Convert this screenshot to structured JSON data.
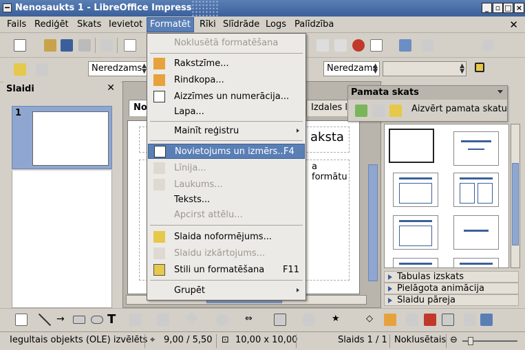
{
  "window": {
    "title": "Nenosaukts 1 - LibreOffice Impress"
  },
  "menubar": {
    "items": [
      {
        "label": "Fails",
        "name": "menu-fails"
      },
      {
        "label": "Rediģēt",
        "name": "menu-rediget"
      },
      {
        "label": "Skats",
        "name": "menu-skats"
      },
      {
        "label": "Ievietot",
        "name": "menu-ievietot"
      },
      {
        "label": "Formatēt",
        "name": "menu-formatet"
      },
      {
        "label": "Rīki",
        "name": "menu-riki"
      },
      {
        "label": "Slīdrāde",
        "name": "menu-slidrade"
      },
      {
        "label": "Logs",
        "name": "menu-logs"
      },
      {
        "label": "Palīdzība",
        "name": "menu-palidziba"
      }
    ]
  },
  "format_menu": {
    "items": [
      {
        "label": "Noklusētā formatēšana",
        "disabled": true
      },
      {
        "label": "Rakstzīme..."
      },
      {
        "label": "Rindkopa..."
      },
      {
        "label": "Aizzīmes un numerācija..."
      },
      {
        "label": "Lapa..."
      },
      {
        "label": "Mainīt reģistru",
        "submenu": true
      },
      {
        "label": "Novietojums un izmērs...",
        "shortcut": "F4",
        "highlighted": true
      },
      {
        "label": "Līnija...",
        "disabled": true
      },
      {
        "label": "Laukums...",
        "disabled": true
      },
      {
        "label": "Teksts..."
      },
      {
        "label": "Apcirst attēlu...",
        "disabled": true
      },
      {
        "label": "Slaida noformējums..."
      },
      {
        "label": "Slaidu izkārtojums...",
        "disabled": true
      },
      {
        "label": "Stili un formatēšana",
        "shortcut": "F11"
      },
      {
        "label": "Grupēt",
        "submenu": true
      }
    ]
  },
  "toolbar2": {
    "font_name": "Neredzams",
    "font_name_right": "Neredzams"
  },
  "slides_panel": {
    "title": "Slaidi",
    "slide_number": "1"
  },
  "workspace": {
    "tab_normal": "No",
    "tab_handout": "Izdales la",
    "title_fragment": "aksta",
    "body_fragment": "a formātu"
  },
  "master_toolbar": {
    "title": "Pamata skats",
    "close_label": "Aizvērt pamata skatu"
  },
  "tasks": {
    "sections": [
      "Tabulas izskats",
      "Pielāgota animācija",
      "Slaidu pāreja"
    ]
  },
  "statusbar": {
    "selection": "Iegultais objekts (OLE) izvēlēts",
    "position": "9,00 / 5,50",
    "size": "10,00 x 10,00",
    "slide": "Slaids 1 / 1",
    "layout": "Noklusētais"
  },
  "colors": {
    "accent": "#5a7fb5",
    "accent_dark": "#3b5f9a",
    "slide_bg": "#8fa7d0"
  }
}
